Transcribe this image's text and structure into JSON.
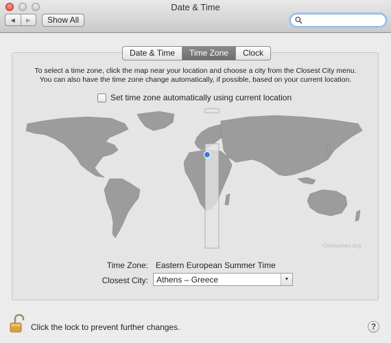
{
  "window": {
    "title": "Date & Time"
  },
  "toolbar": {
    "show_all": "Show All",
    "search_value": ""
  },
  "tabs": [
    {
      "label": "Date & Time",
      "active": false
    },
    {
      "label": "Time Zone",
      "active": true
    },
    {
      "label": "Clock",
      "active": false
    }
  ],
  "timezone": {
    "instruction_line1": "To select a time zone, click the map near your location and choose a city from the Closest City menu.",
    "instruction_line2": "You can also have the time zone change automatically, if possible, based on your current location.",
    "auto_label": "Set time zone automatically using current location",
    "auto_checked": false,
    "map_credit": "Geonames.org",
    "tz_label": "Time Zone:",
    "tz_value": "Eastern European Summer Time",
    "city_label": "Closest City:",
    "city_value": "Athens – Greece"
  },
  "footer": {
    "lock_text": "Click the lock to prevent further changes.",
    "help": "?"
  },
  "colors": {
    "accent": "#2f7de0",
    "land": "#9c9c9c",
    "tab_active": "#767676"
  }
}
